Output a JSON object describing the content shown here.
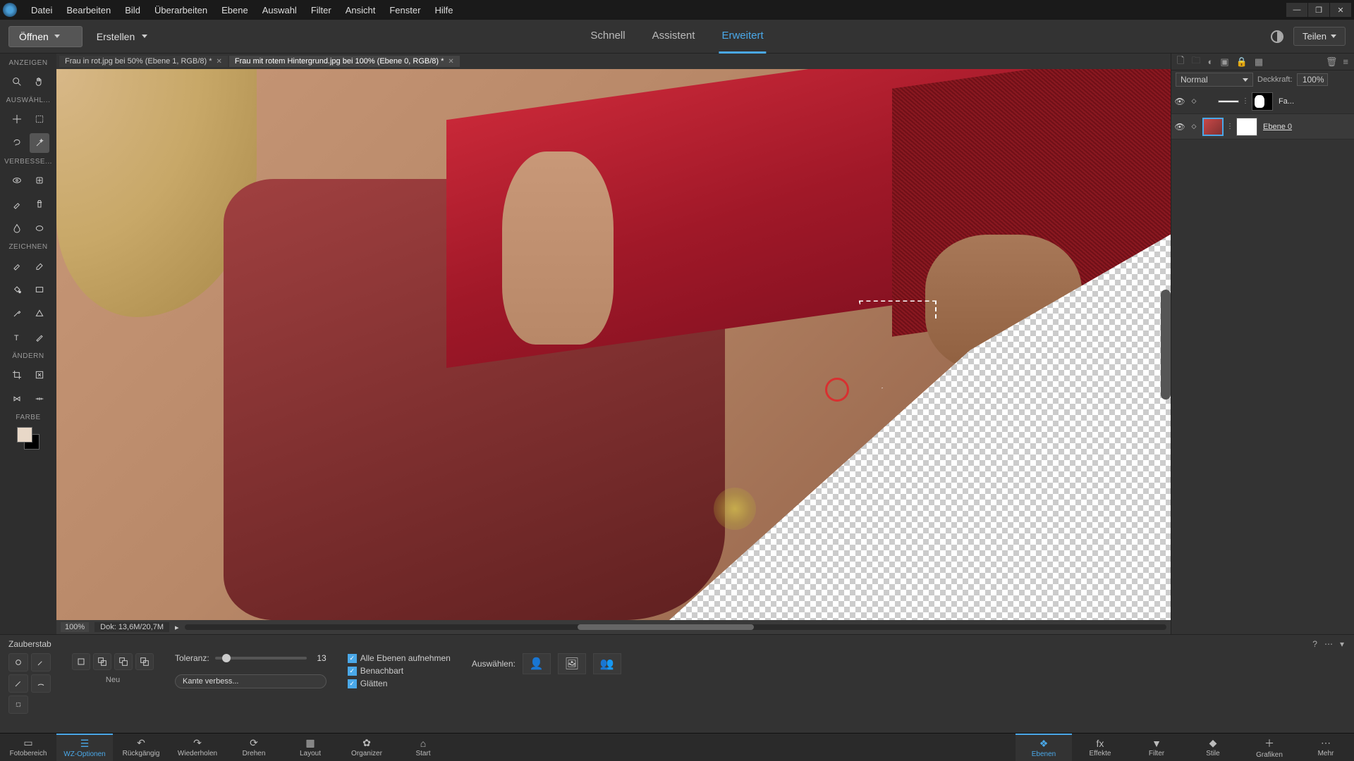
{
  "menubar": [
    "Datei",
    "Bearbeiten",
    "Bild",
    "Überarbeiten",
    "Ebene",
    "Auswahl",
    "Filter",
    "Ansicht",
    "Fenster",
    "Hilfe"
  ],
  "topstrip": {
    "open": "Öffnen",
    "create": "Erstellen",
    "share": "Teilen"
  },
  "modes": {
    "quick": "Schnell",
    "guided": "Assistent",
    "expert": "Erweitert"
  },
  "doc_tabs": [
    {
      "label": "Frau in rot.jpg bei 50% (Ebene 1, RGB/8) *"
    },
    {
      "label": "Frau mit rotem Hintergrund.jpg bei 100% (Ebene 0, RGB/8) *"
    }
  ],
  "tool_sections": {
    "view": "ANZEIGEN",
    "select": "AUSWÄHL...",
    "enhance": "VERBESSE...",
    "draw": "ZEICHNEN",
    "modify": "ÄNDERN",
    "color": "FARBE"
  },
  "status": {
    "zoom": "100%",
    "doc": "Dok: 13,6M/20,7M"
  },
  "layers_panel": {
    "blend": "Normal",
    "opacity_label": "Deckkraft:",
    "opacity": "100%",
    "layer1_name": "Fa...",
    "layer0_name": "Ebene 0"
  },
  "options": {
    "tool_name": "Zauberstab",
    "new_label": "Neu",
    "tolerance_label": "Toleranz:",
    "tolerance_value": "13",
    "refine": "Kante verbess...",
    "chk_all_layers": "Alle Ebenen aufnehmen",
    "chk_contig": "Benachbart",
    "chk_smooth": "Glätten",
    "select_label": "Auswählen:"
  },
  "bottombar": {
    "left": [
      "Fotobereich",
      "WZ-Optionen",
      "Rückgängig",
      "Wiederholen",
      "Drehen",
      "Layout",
      "Organizer",
      "Start"
    ],
    "right": [
      "Ebenen",
      "Effekte",
      "Filter",
      "Stile",
      "Grafiken",
      "Mehr"
    ]
  }
}
